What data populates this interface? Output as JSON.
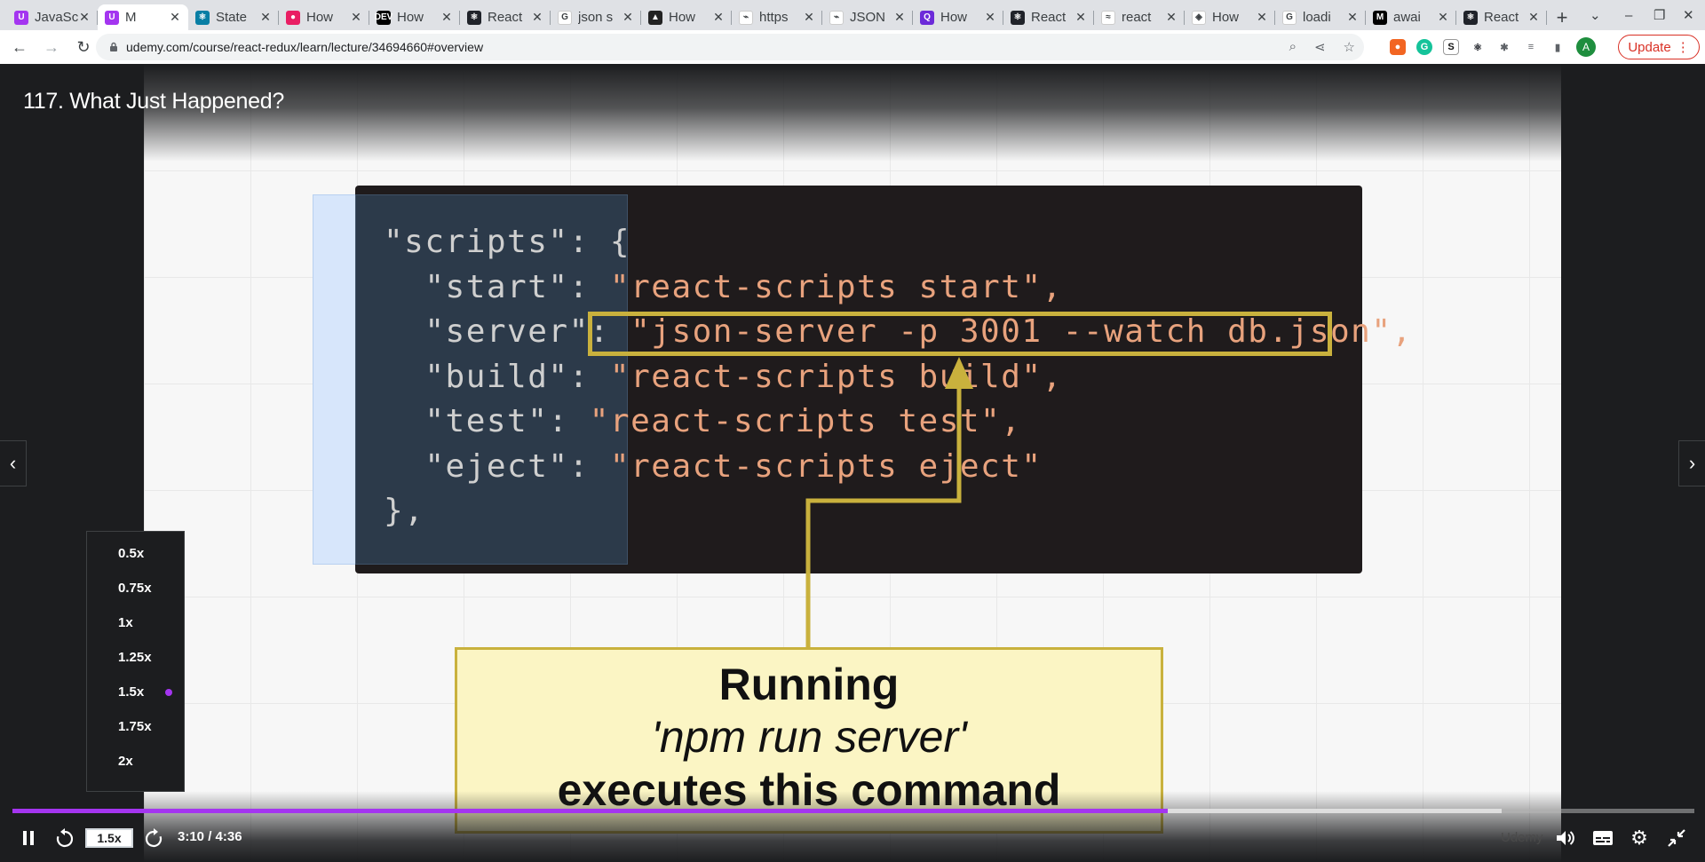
{
  "browser": {
    "tabs": [
      {
        "title": "JavaScript",
        "fav_color": "#a435f0",
        "fav_glyph": "U"
      },
      {
        "title": "M",
        "fav_color": "#a435f0",
        "fav_glyph": "U",
        "active": true
      },
      {
        "title": "State",
        "fav_color": "#087ea4",
        "fav_glyph": "⚛"
      },
      {
        "title": "How",
        "fav_color": "#e91e63",
        "fav_glyph": "●"
      },
      {
        "title": "How",
        "fav_color": "#000000",
        "fav_glyph": "DEV"
      },
      {
        "title": "React",
        "fav_color": "#20232a",
        "fav_glyph": "⚛"
      },
      {
        "title": "json s",
        "fav_color": "#ffffff",
        "fav_glyph": "G"
      },
      {
        "title": "How",
        "fav_color": "#222222",
        "fav_glyph": "▲"
      },
      {
        "title": "https",
        "fav_color": "#ffffff",
        "fav_glyph": "⌁"
      },
      {
        "title": "JSON",
        "fav_color": "#ffffff",
        "fav_glyph": "⌁"
      },
      {
        "title": "How",
        "fav_color": "#6c2bd9",
        "fav_glyph": "Q"
      },
      {
        "title": "React",
        "fav_color": "#20232a",
        "fav_glyph": "⚛"
      },
      {
        "title": "react",
        "fav_color": "#ffffff",
        "fav_glyph": "≈"
      },
      {
        "title": "How",
        "fav_color": "#ffffff",
        "fav_glyph": "◈"
      },
      {
        "title": "loadi",
        "fav_color": "#ffffff",
        "fav_glyph": "G"
      },
      {
        "title": "awai",
        "fav_color": "#000000",
        "fav_glyph": "M"
      },
      {
        "title": "React",
        "fav_color": "#20232a",
        "fav_glyph": "⚛"
      }
    ],
    "new_tab": "+",
    "url": "udemy.com/course/react-redux/learn/lecture/34694660#overview",
    "update_label": "Update",
    "profile_initial": "A"
  },
  "player": {
    "lecture_title": "117. What Just Happened?",
    "code_lines": [
      {
        "key": "\"scripts\": {",
        "val": ""
      },
      {
        "key": "  \"start\": ",
        "val": "\"react-scripts start\","
      },
      {
        "key": "  \"server\": ",
        "val": "\"json-server -p 3001 --watch db.json\","
      },
      {
        "key": "  \"build\": ",
        "val": "\"react-scripts build\","
      },
      {
        "key": "  \"test\": ",
        "val": "\"react-scripts test\","
      },
      {
        "key": "  \"eject\": ",
        "val": "\"react-scripts eject\""
      },
      {
        "key": "},",
        "val": ""
      }
    ],
    "callout": {
      "line1": "Running",
      "line2": "'npm run server'",
      "line3": "executes this command"
    },
    "speed_options": [
      "0.5x",
      "0.75x",
      "1x",
      "1.25x",
      "1.5x",
      "1.75x",
      "2x"
    ],
    "selected_speed": "1.5x",
    "rate_label": "1.5x",
    "time_display": "3:10 / 4:36",
    "progress_fraction": 0.6868,
    "buffer_fraction": 0.8853,
    "accent_color": "#a435f0",
    "watermark": "Udemy"
  }
}
